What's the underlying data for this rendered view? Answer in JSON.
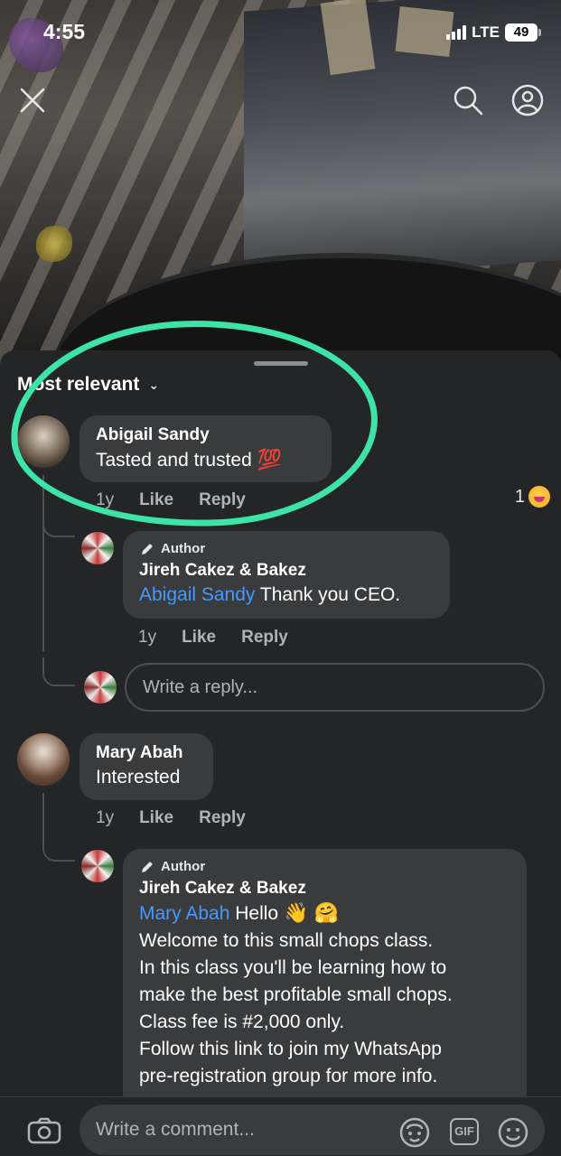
{
  "status_bar": {
    "time": "4:55",
    "network": "LTE",
    "battery": "49"
  },
  "sort": {
    "label": "Most relevant"
  },
  "comments": [
    {
      "name": "Abigail Sandy",
      "text": "Tasted and trusted",
      "emoji": "💯",
      "age": "1y",
      "like": "Like",
      "reply": "Reply",
      "reaction_count": "1"
    },
    {
      "author_tag": "Author",
      "name": "Jireh Cakez & Bakez",
      "mention": "Abigail Sandy",
      "text": "Thank you CEO.",
      "age": "1y",
      "like": "Like",
      "reply": "Reply"
    },
    {
      "name": "Mary Abah",
      "text": "Interested",
      "age": "1y",
      "like": "Like",
      "reply": "Reply"
    },
    {
      "author_tag": "Author",
      "name": "Jireh Cakez & Bakez",
      "mention": "Mary Abah",
      "greeting": "Hello",
      "greeting_emojis": "👋 🤗",
      "lines": [
        "Welcome to this small chops class.",
        "In this class you'll be learning how to",
        "make the best profitable small chops.",
        "Class fee is #2,000 only.",
        "Follow this link to join my WhatsApp",
        "pre-registration group for more info."
      ]
    }
  ],
  "reply_input": {
    "placeholder": "Write a reply..."
  },
  "comment_input": {
    "placeholder": "Write a comment..."
  },
  "gif_label": "GIF",
  "colors": {
    "sheet": "#242526",
    "bubble": "#3a3b3c",
    "mention": "#4599ff",
    "highlight": "#3ee3a8"
  },
  "icons": [
    "close-icon",
    "search-icon",
    "profile-icon",
    "chevron-down-icon",
    "pencil-icon",
    "camera-icon",
    "avatar-sticker-icon",
    "gif-icon",
    "emoji-icon"
  ]
}
